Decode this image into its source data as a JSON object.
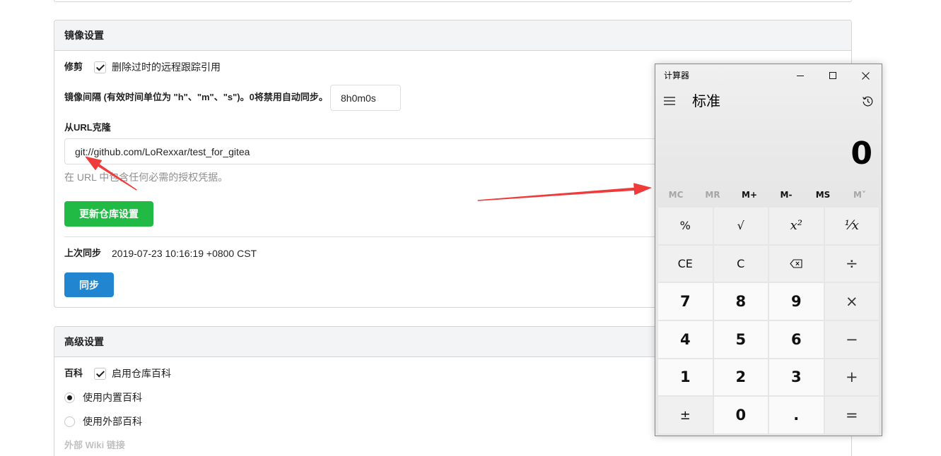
{
  "mirror_settings": {
    "title": "镜像设置",
    "prune": {
      "label": "修剪",
      "checkbox_label": "删除过时的远程跟踪引用",
      "checked": true
    },
    "interval": {
      "label": "镜像间隔 (有效时间单位为 \"h\"、\"m\"、\"s\")。0将禁用自动同步。",
      "value": "8h0m0s"
    },
    "clone_url": {
      "label": "从URL克隆",
      "value": "git://github.com/LoRexxar/test_for_gitea",
      "help": "在 URL 中包含任何必需的授权凭据。"
    },
    "update_button": "更新仓库设置",
    "last_sync": {
      "label": "上次同步",
      "value": "2019-07-23 10:16:19 +0800 CST"
    },
    "sync_button": "同步"
  },
  "advanced_settings": {
    "title": "高级设置",
    "wiki": {
      "label": "百科",
      "checkbox_label": "启用仓库百科",
      "checked": true
    },
    "wiki_options": [
      {
        "label": "使用内置百科",
        "selected": true
      },
      {
        "label": "使用外部百科",
        "selected": false
      }
    ],
    "external_wiki_label": "外部 Wiki 链接"
  },
  "calculator": {
    "title": "计算器",
    "window_controls": [
      "minimize-icon",
      "maximize-icon",
      "close-icon"
    ],
    "menu_icon": "hamburger-icon",
    "history_icon": "history-icon",
    "mode": "标准",
    "display": "0",
    "memory": [
      {
        "label": "MC",
        "enabled": false
      },
      {
        "label": "MR",
        "enabled": false
      },
      {
        "label": "M+",
        "enabled": true
      },
      {
        "label": "M-",
        "enabled": true
      },
      {
        "label": "MS",
        "enabled": true
      },
      {
        "label": "M˅",
        "enabled": false
      }
    ],
    "keys": [
      {
        "label": "%"
      },
      {
        "label": "√"
      },
      {
        "label": "x²"
      },
      {
        "label": "¹⁄x"
      },
      {
        "label": "CE"
      },
      {
        "label": "C"
      },
      {
        "icon": "backspace-icon"
      },
      {
        "label": "÷"
      },
      {
        "label": "7"
      },
      {
        "label": "8"
      },
      {
        "label": "9"
      },
      {
        "label": "×"
      },
      {
        "label": "4"
      },
      {
        "label": "5"
      },
      {
        "label": "6"
      },
      {
        "label": "−"
      },
      {
        "label": "1"
      },
      {
        "label": "2"
      },
      {
        "label": "3"
      },
      {
        "label": "+"
      },
      {
        "label": "±"
      },
      {
        "label": "0"
      },
      {
        "label": "."
      },
      {
        "label": "="
      }
    ]
  },
  "colors": {
    "green_button": "#21ba45",
    "blue_button": "#2185d0",
    "annotation_arrow": "#ef3b3a"
  }
}
